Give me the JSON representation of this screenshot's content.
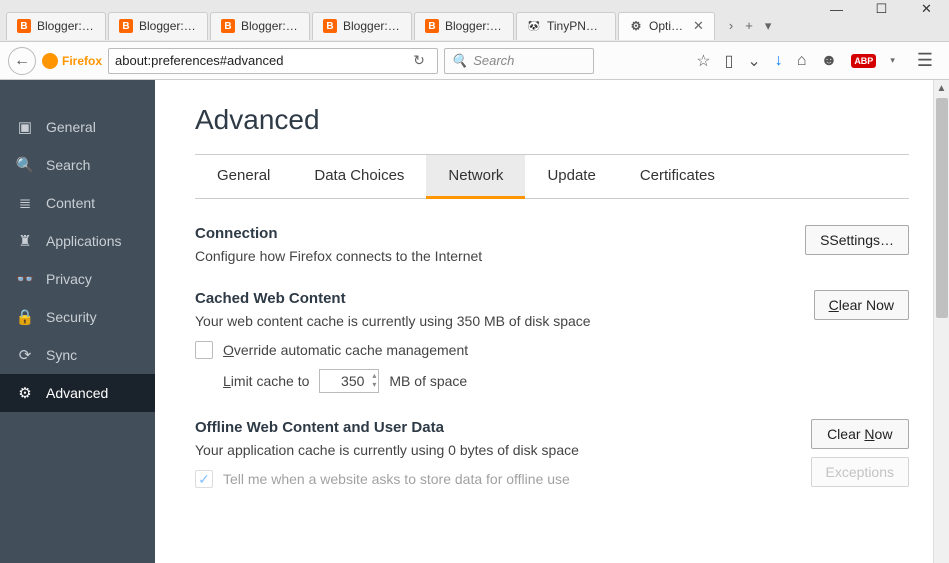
{
  "window": {
    "min": "—",
    "max": "☐",
    "close": "✕"
  },
  "tabs": [
    {
      "icon": "B",
      "label": "Blogger: …"
    },
    {
      "icon": "B",
      "label": "Blogger: …"
    },
    {
      "icon": "B",
      "label": "Blogger: …"
    },
    {
      "icon": "B",
      "label": "Blogger: …"
    },
    {
      "icon": "B",
      "label": "Blogger: …"
    },
    {
      "icon": "panda",
      "label": "TinyPNG …"
    },
    {
      "icon": "gear",
      "label": "Opti…",
      "active": true
    }
  ],
  "tabstrip_after": {
    "arrow": "›",
    "plus": "+",
    "dropdown": "▾"
  },
  "navbar": {
    "back": "←",
    "identity": "Firefox",
    "url": "about:preferences#advanced",
    "reload": "↻",
    "search_placeholder": "Search",
    "icons": {
      "star": "☆",
      "reader": "▯",
      "pocket": "⌄",
      "download": "↓",
      "home": "⌂",
      "chat": "☻",
      "abp": "ABP",
      "menu": "☰"
    }
  },
  "sidebar": [
    {
      "icon": "▣",
      "label": "General"
    },
    {
      "icon": "🔍",
      "label": "Search"
    },
    {
      "icon": "≣",
      "label": "Content"
    },
    {
      "icon": "♜",
      "label": "Applications"
    },
    {
      "icon": "👓",
      "label": "Privacy"
    },
    {
      "icon": "🔒",
      "label": "Security"
    },
    {
      "icon": "⟳",
      "label": "Sync"
    },
    {
      "icon": "⚙",
      "label": "Advanced",
      "active": true
    }
  ],
  "page": {
    "title": "Advanced",
    "subtabs": [
      "General",
      "Data Choices",
      "Network",
      "Update",
      "Certificates"
    ],
    "active_subtab": "Network",
    "connection": {
      "title": "Connection",
      "text": "Configure how Firefox connects to the Internet",
      "button": "Settings…"
    },
    "cache": {
      "title": "Cached Web Content",
      "text": "Your web content cache is currently using 350 MB of disk space",
      "button_pre": "C",
      "button_rest": "lear Now",
      "override_pre": "O",
      "override_rest": "verride automatic cache management",
      "limit_pre": "L",
      "limit_rest": "imit cache to",
      "limit_value": "350",
      "limit_suffix": "MB of space"
    },
    "offline": {
      "title": "Offline Web Content and User Data",
      "text": "Your application cache is currently using 0 bytes of disk space",
      "button_pre": "Clear ",
      "button_u": "N",
      "button_post": "ow",
      "tell_text": "Tell me when a website asks to store data for offline use",
      "exceptions": "Exceptions"
    }
  }
}
